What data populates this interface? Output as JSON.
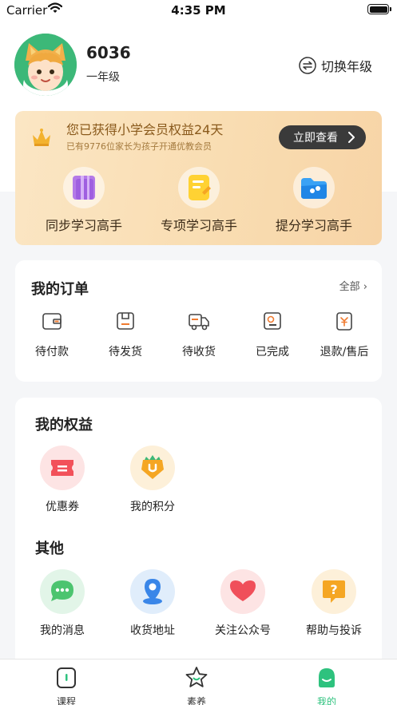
{
  "status_bar": {
    "carrier": "Carrier",
    "time": "4:35 PM"
  },
  "profile": {
    "username": "6036",
    "grade": "一年级",
    "switch_label": "切换年级"
  },
  "vip": {
    "title": "您已获得小学会员权益24天",
    "subtitle": "已有9776位家长为孩子开通优教会员",
    "button_label": "立即查看",
    "features": [
      {
        "label": "同步学习高手",
        "icon": "purple-book-icon"
      },
      {
        "label": "专项学习高手",
        "icon": "yellow-note-icon"
      },
      {
        "label": "提分学习高手",
        "icon": "blue-folder-icon"
      }
    ]
  },
  "orders": {
    "title": "我的订单",
    "all_label": "全部",
    "items": [
      {
        "label": "待付款",
        "icon": "wallet-icon"
      },
      {
        "label": "待发货",
        "icon": "package-icon"
      },
      {
        "label": "待收货",
        "icon": "truck-icon"
      },
      {
        "label": "已完成",
        "icon": "completed-box-icon"
      },
      {
        "label": "退款/售后",
        "icon": "refund-bag-icon"
      }
    ]
  },
  "benefits": {
    "title": "我的权益",
    "items": [
      {
        "label": "优惠券",
        "icon": "coupon-icon"
      },
      {
        "label": "我的积分",
        "icon": "points-icon"
      }
    ]
  },
  "others": {
    "title": "其他",
    "items": [
      {
        "label": "我的消息",
        "icon": "message-icon"
      },
      {
        "label": "收货地址",
        "icon": "location-icon"
      },
      {
        "label": "关注公众号",
        "icon": "heart-icon"
      },
      {
        "label": "帮助与投诉",
        "icon": "help-icon"
      }
    ]
  },
  "tabbar": {
    "items": [
      {
        "label": "课程",
        "icon": "course-icon"
      },
      {
        "label": "素养",
        "icon": "star-icon"
      },
      {
        "label": "我的",
        "icon": "mine-icon"
      }
    ],
    "active": "我的"
  },
  "colors": {
    "accent": "#2ec27e",
    "vip_text": "#8a5a1c",
    "background": "#f5f6f8"
  }
}
